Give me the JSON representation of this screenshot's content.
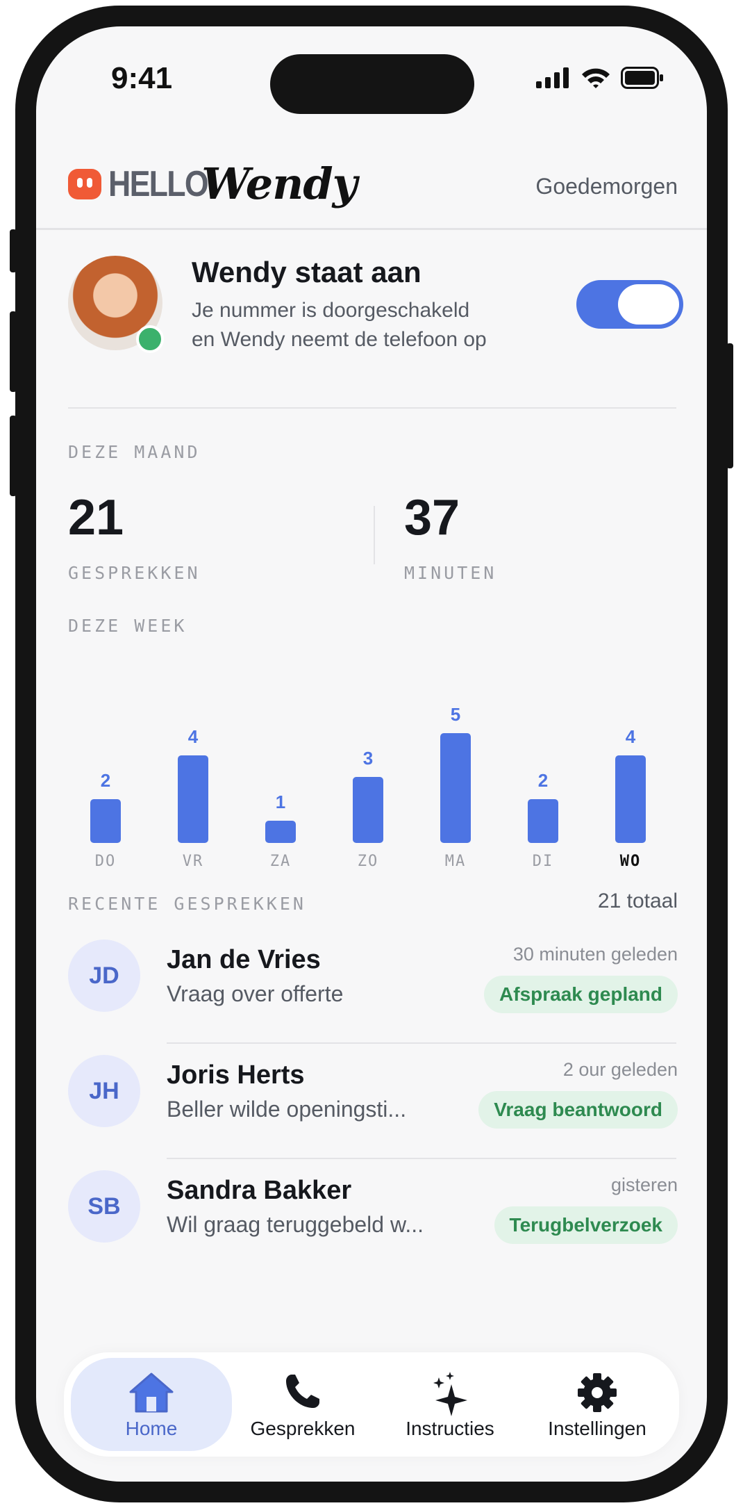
{
  "status_bar": {
    "time": "9:41"
  },
  "header": {
    "logo_hello": "HELLO",
    "logo_wendy": "Wendy",
    "greeting": "Goedemorgen"
  },
  "status_card": {
    "title": "Wendy staat aan",
    "subtitle_line1": "Je nummer is doorgeschakeld",
    "subtitle_line2": "en Wendy neemt de telefoon op",
    "toggle_on": true,
    "toggle_color": "#4d74e3",
    "online_color": "#3bb16c"
  },
  "month": {
    "label": "DEZE MAAND",
    "calls_value": "21",
    "calls_label": "GESPREKKEN",
    "minutes_value": "37",
    "minutes_label": "MINUTEN"
  },
  "week": {
    "label": "DEZE WEEK"
  },
  "chart_data": {
    "type": "bar",
    "categories": [
      "DO",
      "VR",
      "ZA",
      "ZO",
      "MA",
      "DI",
      "WO"
    ],
    "values": [
      2,
      4,
      1,
      3,
      5,
      2,
      4
    ],
    "highlight_category": "WO",
    "bar_color": "#4d74e3",
    "ylim": [
      0,
      5
    ]
  },
  "recent": {
    "label": "RECENTE GESPREKKEN",
    "total": "21 totaal",
    "items": [
      {
        "initials": "JD",
        "name": "Jan de Vries",
        "desc": "Vraag over offerte",
        "time": "30 minuten geleden",
        "badge": "Afspraak gepland"
      },
      {
        "initials": "JH",
        "name": "Joris Herts",
        "desc": "Beller wilde openingsti...",
        "time": "2 our geleden",
        "badge": "Vraag beantwoord"
      },
      {
        "initials": "SB",
        "name": "Sandra Bakker",
        "desc": "Wil graag teruggebeld w...",
        "time": "gisteren",
        "badge": "Terugbelverzoek"
      }
    ]
  },
  "nav": {
    "items": [
      {
        "label": "Home",
        "icon": "home-icon",
        "active": true
      },
      {
        "label": "Gesprekken",
        "icon": "phone-icon",
        "active": false
      },
      {
        "label": "Instructies",
        "icon": "sparkle-icon",
        "active": false
      },
      {
        "label": "Instellingen",
        "icon": "gear-icon",
        "active": false
      }
    ]
  }
}
